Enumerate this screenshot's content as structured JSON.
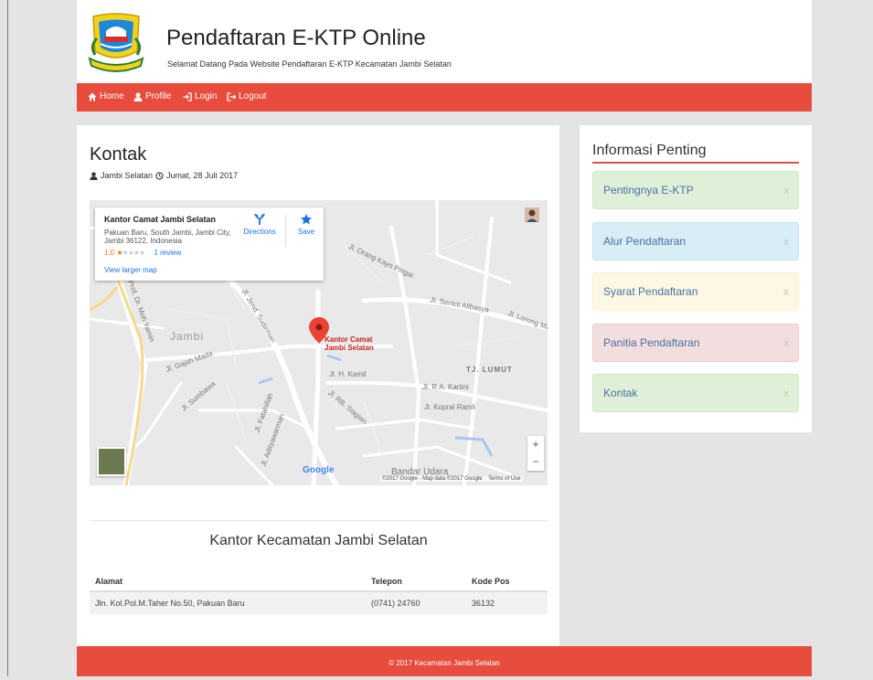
{
  "header": {
    "title": "Pendaftaran E-KTP Online",
    "subtitle": "Selamat Datang Pada Website Pendaftaran E-KTP Kecamatan Jambi Selatan"
  },
  "nav": {
    "items": [
      {
        "label": "Home",
        "icon": "home-icon"
      },
      {
        "label": "Profile",
        "icon": "user-icon"
      },
      {
        "label": "Login",
        "icon": "login-icon"
      },
      {
        "label": "Logout",
        "icon": "logout-icon"
      }
    ]
  },
  "post": {
    "title": "Kontak",
    "author": "Jambi Selatan",
    "date": "Jumat, 28 Juli 2017"
  },
  "map": {
    "place_name": "Kantor Camat Jambi Selatan",
    "address": "Pakuan Baru, South Jambi, Jambi City, Jambi 36122, Indonesia",
    "rating": "1.0",
    "reviews": "1 review",
    "larger_map": "View larger map",
    "directions": "Directions",
    "save": "Save",
    "pin_label_1": "Kantor Camat",
    "pin_label_2": "Jambi Selatan",
    "area_jambi": "Jambi",
    "area_tj_lumut": "TJ. LUMUT",
    "bandar_udara": "Bandar Udara",
    "google": "Google",
    "attribution": "©2017 Google - Map data ©2017 Google",
    "terms": "Terms of Use",
    "zoom_in": "+",
    "zoom_out": "−",
    "streets": [
      "Jl. Gajah Mada",
      "Jl. Prof. Dr. Moh Yamin",
      "Jl. Jend. Sudirman",
      "Jl. Sentot Alibasya",
      "Jl. Orang Kayo Pingai",
      "Jl. H. Kamil",
      "Jl. RB. Siagian",
      "Jl. Kopral Ramli",
      "Jl. R.A. Kartini",
      "Jl. Lorong Mayang",
      "Jl. Adityawarman",
      "Jl. Sumbawa",
      "Jl. Fatahillah"
    ]
  },
  "office": {
    "title": "Kantor Kecamatan Jambi Selatan",
    "columns": [
      "Alamat",
      "Telepon",
      "Kode Pos"
    ],
    "rows": [
      [
        "Jln. Kol.Pol.M.Taher No.50, Pakuan Baru",
        "(0741) 24760",
        "36132"
      ]
    ]
  },
  "sidebar": {
    "title": "Informasi Penting",
    "items": [
      {
        "label": "Pentingnya E-KTP",
        "close": "x"
      },
      {
        "label": "Alur Pendaftaran",
        "close": "x"
      },
      {
        "label": "Syarat Pendaftaran",
        "close": "x"
      },
      {
        "label": "Panitia Pendaftaran",
        "close": "x"
      },
      {
        "label": "Kontak",
        "close": "x"
      }
    ]
  },
  "footer": {
    "text": "© 2017 Kecamatan Jambi Selatan"
  },
  "colors": {
    "accent": "#e74c3c",
    "link": "#4a6fa5"
  }
}
